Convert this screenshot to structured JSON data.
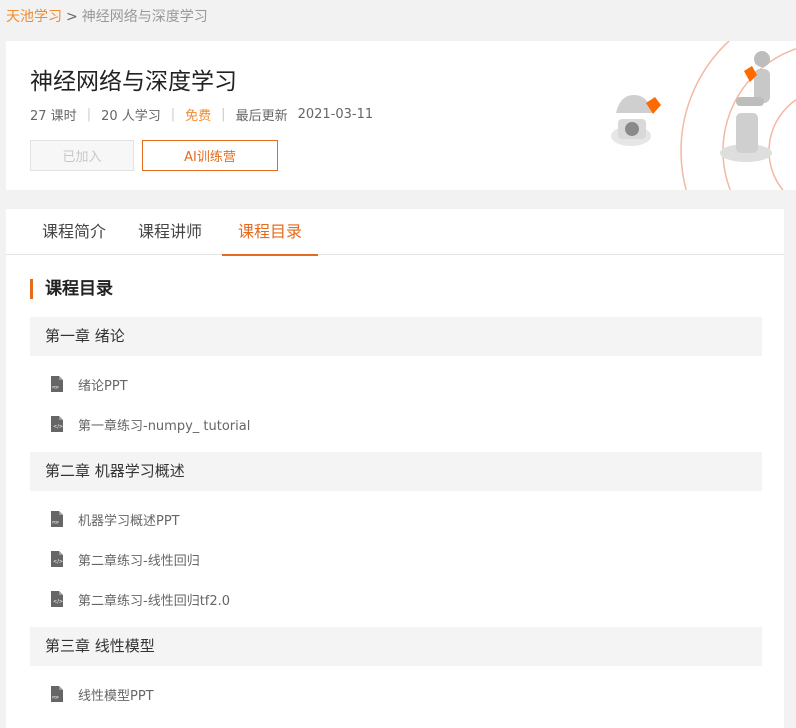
{
  "breadcrumb": {
    "home": "天池学习",
    "sep": ">",
    "current": "神经网络与深度学习"
  },
  "course": {
    "title": "神经网络与深度学习",
    "lessons": "27 课时",
    "students": "20 人学习",
    "price": "免费",
    "updated_label": "最后更新",
    "updated": "2021-03-11",
    "meta_sep": "|",
    "joined_label": "已加入",
    "camp_label": "AI训练营"
  },
  "colors": {
    "accent": "#e56b1f",
    "link": "#f08c2e"
  },
  "tabs": [
    {
      "label": "课程简介"
    },
    {
      "label": "课程讲师"
    },
    {
      "label": "课程目录",
      "active": true
    }
  ],
  "catalog": {
    "title": "课程目录",
    "chapters": [
      {
        "title": "第一章 绪论",
        "items": [
          {
            "label": "绪论PPT",
            "icon": "pdf-file-icon"
          },
          {
            "label": "第一章练习-numpy_ tutorial",
            "icon": "code-file-icon"
          }
        ]
      },
      {
        "title": "第二章 机器学习概述",
        "items": [
          {
            "label": "机器学习概述PPT",
            "icon": "pdf-file-icon"
          },
          {
            "label": "第二章练习-线性回归",
            "icon": "code-file-icon"
          },
          {
            "label": "第二章练习-线性回归tf2.0",
            "icon": "code-file-icon"
          }
        ]
      },
      {
        "title": "第三章 线性模型",
        "items": [
          {
            "label": "线性模型PPT",
            "icon": "pdf-file-icon"
          }
        ]
      }
    ]
  }
}
